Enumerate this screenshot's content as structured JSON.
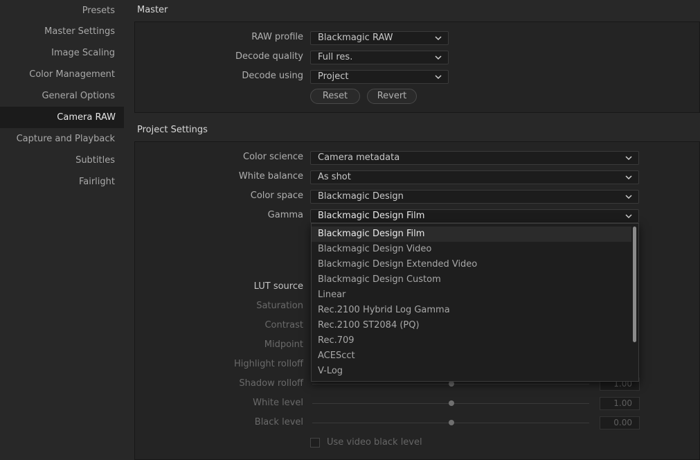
{
  "sidebar": {
    "items": [
      {
        "label": "Presets"
      },
      {
        "label": "Master Settings"
      },
      {
        "label": "Image Scaling"
      },
      {
        "label": "Color Management"
      },
      {
        "label": "General Options"
      },
      {
        "label": "Camera RAW"
      },
      {
        "label": "Capture and Playback"
      },
      {
        "label": "Subtitles"
      },
      {
        "label": "Fairlight"
      }
    ],
    "active": "Camera RAW"
  },
  "master": {
    "title": "Master",
    "raw_profile_label": "RAW profile",
    "raw_profile_value": "Blackmagic RAW",
    "decode_quality_label": "Decode quality",
    "decode_quality_value": "Full res.",
    "decode_using_label": "Decode using",
    "decode_using_value": "Project",
    "reset_label": "Reset",
    "revert_label": "Revert"
  },
  "project": {
    "title": "Project Settings",
    "color_science_label": "Color science",
    "color_science_value": "Camera metadata",
    "white_balance_label": "White balance",
    "white_balance_value": "As shot",
    "color_space_label": "Color space",
    "color_space_value": "Blackmagic Design",
    "gamma_label": "Gamma",
    "gamma_value": "Blackmagic Design Film",
    "lut_source_label": "LUT source",
    "saturation_label": "Saturation",
    "contrast_label": "Contrast",
    "midpoint_label": "Midpoint",
    "highlight_rolloff_label": "Highlight rolloff",
    "shadow_rolloff_label": "Shadow rolloff",
    "shadow_rolloff_value": "1.00",
    "white_level_label": "White level",
    "white_level_value": "1.00",
    "black_level_label": "Black level",
    "black_level_value": "0.00",
    "use_video_black_label": "Use video black level"
  },
  "gamma_dropdown": {
    "options": [
      "Blackmagic Design Film",
      "Blackmagic Design Video",
      "Blackmagic Design Extended Video",
      "Blackmagic Design Custom",
      "Linear",
      "Rec.2100 Hybrid Log Gamma",
      "Rec.2100 ST2084 (PQ)",
      "Rec.709",
      "ACEScct",
      "V-Log"
    ],
    "selected": "Blackmagic Design Film"
  },
  "icons": {
    "chevron": "chevron-down-icon"
  }
}
